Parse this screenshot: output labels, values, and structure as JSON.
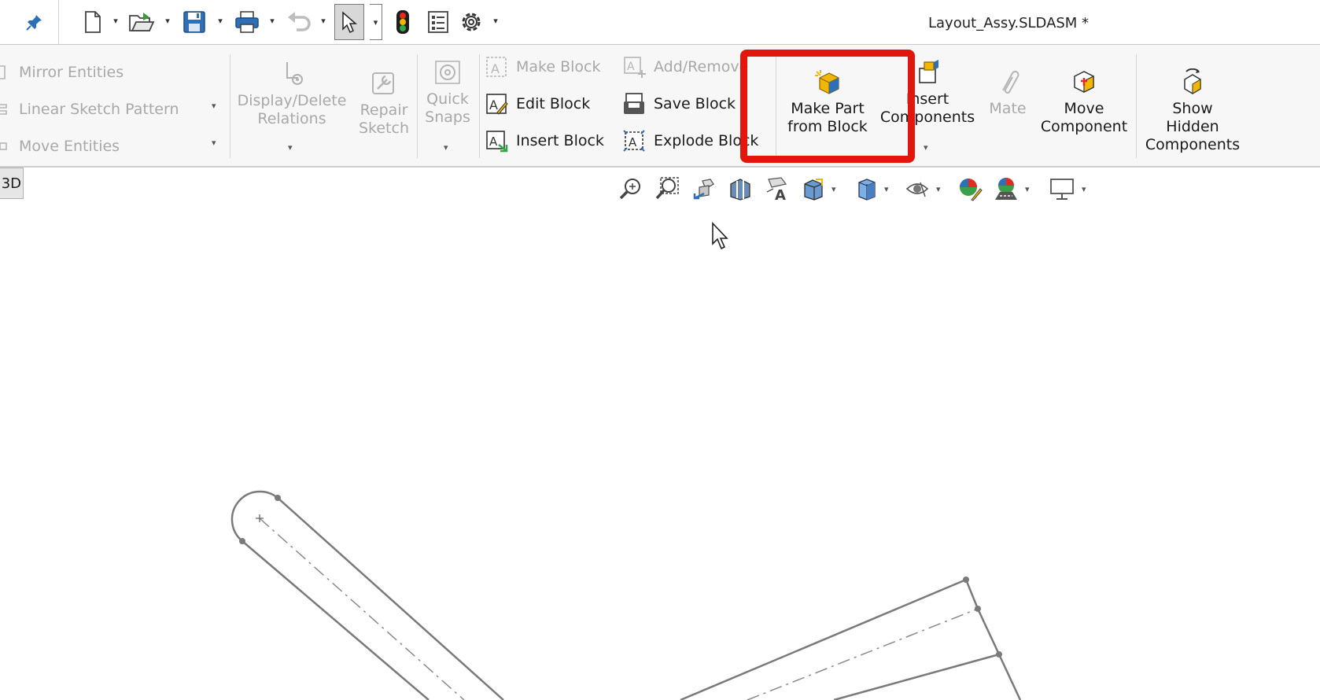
{
  "window": {
    "title": "Layout_Assy.SLDASM *"
  },
  "quick_access": {
    "items": [
      {
        "name": "pin-icon"
      },
      {
        "name": "new-document-icon"
      },
      {
        "name": "open-icon"
      },
      {
        "name": "save-icon"
      },
      {
        "name": "print-icon"
      },
      {
        "name": "undo-icon"
      },
      {
        "name": "select-pointer-icon"
      },
      {
        "name": "rebuild-icon"
      },
      {
        "name": "file-properties-icon"
      },
      {
        "name": "options-gear-icon"
      }
    ]
  },
  "ribbon": {
    "sketch_tools": [
      {
        "label": "Mirror Entities",
        "enabled": false
      },
      {
        "label": "Linear Sketch Pattern",
        "enabled": false
      },
      {
        "label": "Move Entities",
        "enabled": false
      }
    ],
    "display_delete_relations": {
      "line1": "Display/Delete",
      "line2": "Relations"
    },
    "repair_sketch": {
      "line1": "Repair",
      "line2": "Sketch"
    },
    "quick_snaps": {
      "line1": "Quick",
      "line2": "Snaps"
    },
    "block_col1": [
      {
        "label": "Make Block",
        "enabled": false
      },
      {
        "label": "Edit Block",
        "enabled": true
      },
      {
        "label": "Insert Block",
        "enabled": true
      }
    ],
    "block_col2": [
      {
        "label": "Add/Remove",
        "enabled": false
      },
      {
        "label": "Save Block",
        "enabled": true
      },
      {
        "label": "Explode Block",
        "enabled": true
      }
    ],
    "make_part_from_block": {
      "line1": "Make Part",
      "line2": "from Block"
    },
    "insert_components": {
      "line1": "Insert",
      "line2": "Components"
    },
    "mate": {
      "label": "Mate"
    },
    "move_component": {
      "line1": "Move",
      "line2": "Component"
    },
    "show_hidden_components": {
      "line1": "Show",
      "line2": "Hidden",
      "line3": "Components"
    }
  },
  "view_tab": {
    "label": "3D"
  },
  "view_toolbar": [
    {
      "name": "zoom-to-fit-icon"
    },
    {
      "name": "zoom-to-area-icon"
    },
    {
      "name": "previous-view-icon"
    },
    {
      "name": "section-view-icon"
    },
    {
      "name": "dynamic-annotation-views-icon"
    },
    {
      "name": "view-orientation-icon"
    },
    {
      "name": "display-style-icon"
    },
    {
      "name": "hide-show-items-icon"
    },
    {
      "name": "edit-appearance-icon"
    },
    {
      "name": "apply-scene-icon"
    },
    {
      "name": "view-settings-icon"
    }
  ],
  "colors": {
    "highlight": "#e3160c",
    "accent_yellow": "#f2b705",
    "accent_blue": "#2e6fb7",
    "sketch_line": "#7a7a7a"
  }
}
